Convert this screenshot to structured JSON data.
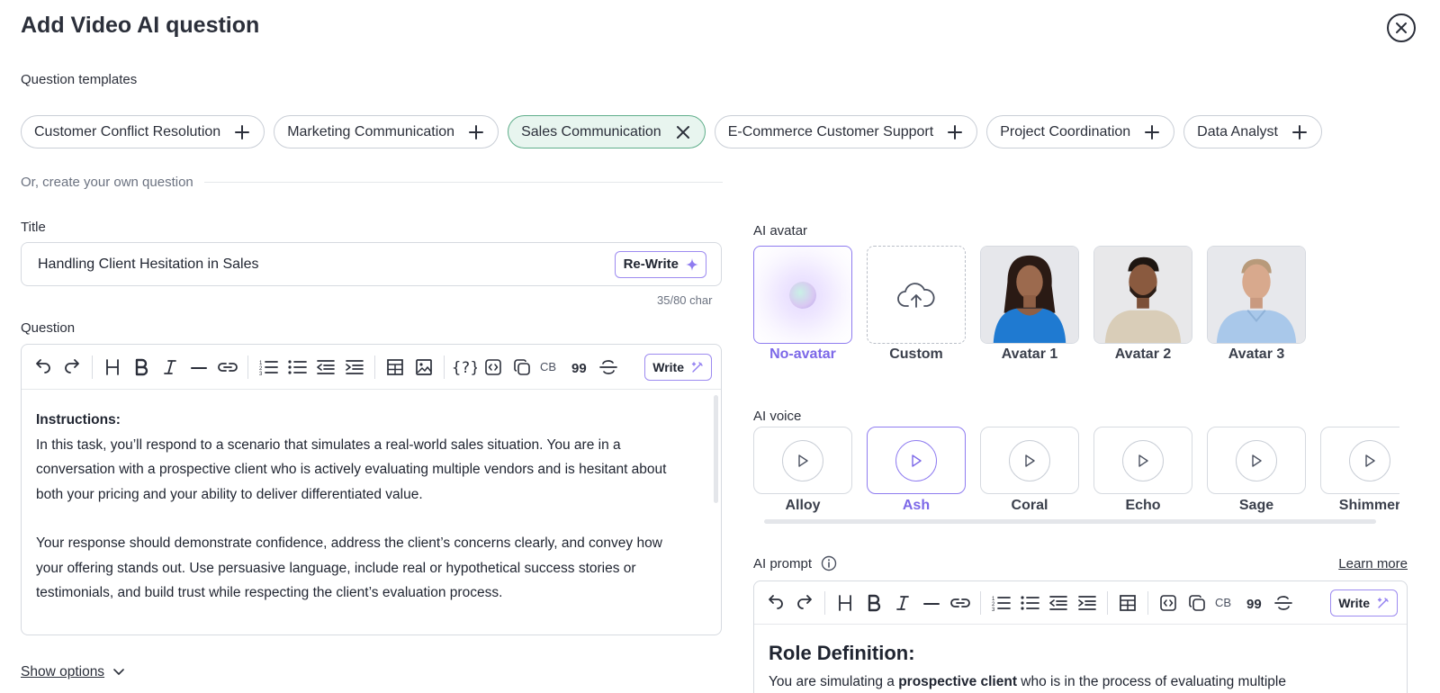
{
  "header": {
    "title": "Add Video AI question"
  },
  "templates": {
    "label": "Question templates",
    "chips": [
      {
        "label": "Customer Conflict Resolution",
        "active": false
      },
      {
        "label": "Marketing Communication",
        "active": false
      },
      {
        "label": "Sales Communication",
        "active": true
      },
      {
        "label": "E-Commerce Customer Support",
        "active": false
      },
      {
        "label": "Project Coordination",
        "active": false
      },
      {
        "label": "Data Analyst",
        "active": false
      }
    ]
  },
  "create_own": "Or, create your own question",
  "title_field": {
    "label": "Title",
    "value": "Handling Client Hesitation in Sales",
    "rewrite_label": "Re-Write",
    "char_count": "35/80 char"
  },
  "question": {
    "label": "Question",
    "write_label": "Write",
    "instructions_heading": "Instructions:",
    "paragraph1": "In this task, you’ll respond to a scenario that simulates a real-world sales situation. You are in a conversation with a prospective client who is actively evaluating multiple vendors and is hesitant about both your pricing and your ability to deliver differentiated value.",
    "paragraph2": "Your response should demonstrate confidence, address the client’s concerns clearly, and convey how your offering stands out. Use persuasive language, include real or hypothetical success stories or testimonials, and build trust while respecting the client’s evaluation process."
  },
  "show_options": "Show options",
  "ai_avatar": {
    "label": "AI avatar",
    "items": [
      {
        "label": "No-avatar",
        "selected": true
      },
      {
        "label": "Custom",
        "selected": false
      },
      {
        "label": "Avatar 1",
        "selected": false
      },
      {
        "label": "Avatar 2",
        "selected": false
      },
      {
        "label": "Avatar 3",
        "selected": false
      }
    ]
  },
  "ai_voice": {
    "label": "AI voice",
    "items": [
      {
        "label": "Alloy",
        "selected": false
      },
      {
        "label": "Ash",
        "selected": true
      },
      {
        "label": "Coral",
        "selected": false
      },
      {
        "label": "Echo",
        "selected": false
      },
      {
        "label": "Sage",
        "selected": false
      },
      {
        "label": "Shimmer",
        "selected": false
      }
    ]
  },
  "ai_prompt": {
    "label": "AI prompt",
    "learn_more": "Learn more",
    "write_label": "Write",
    "heading": "Role Definition:",
    "line_prefix": "You are simulating a ",
    "line_bold": "prospective client",
    "line_suffix": " who is in the process of evaluating multiple"
  },
  "colors": {
    "accent": "#7c68e8",
    "active_chip_bg": "#e8f5ef",
    "active_chip_border": "#5fae8a"
  }
}
